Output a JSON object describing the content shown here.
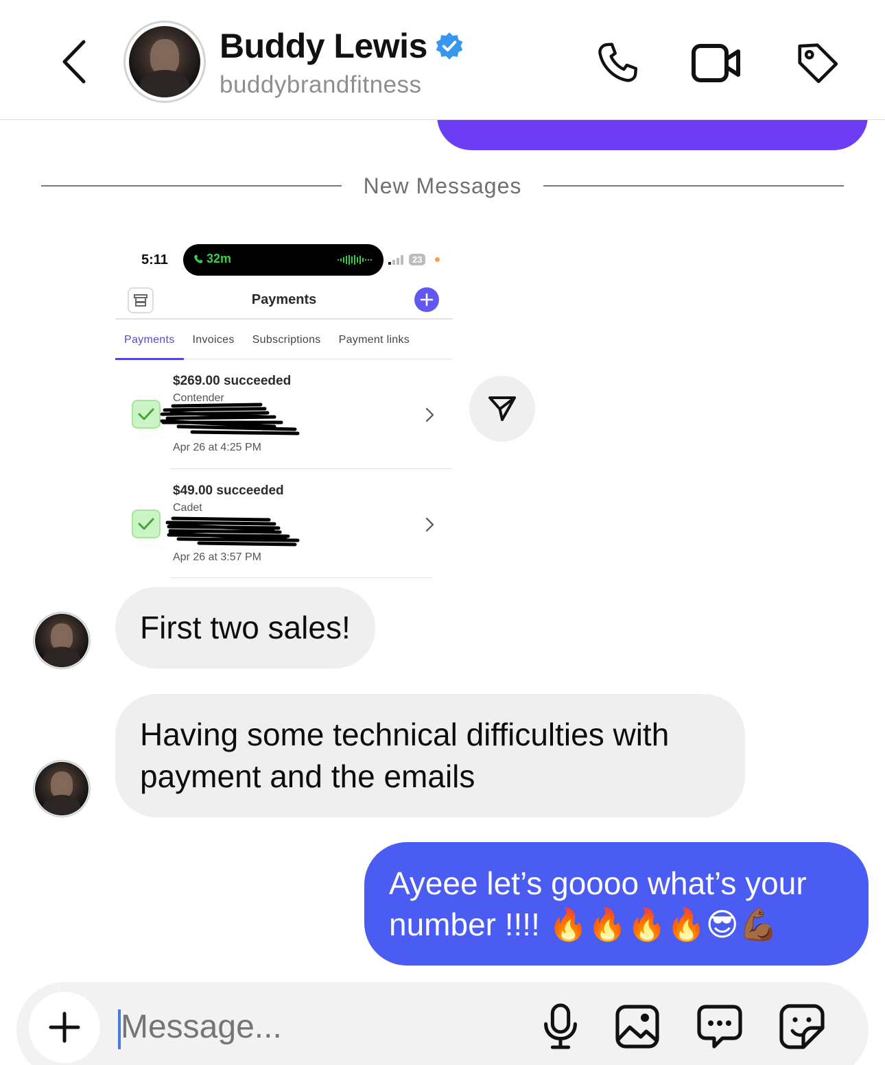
{
  "header": {
    "name": "Buddy Lewis",
    "username": "buddybrandfitness"
  },
  "divider": {
    "label": "New Messages"
  },
  "shared_screenshot": {
    "status_time": "5:11",
    "call_duration": "32m",
    "battery": "23",
    "app_title": "Payments",
    "tabs": [
      "Payments",
      "Invoices",
      "Subscriptions",
      "Payment links"
    ],
    "active_tab": "Payments",
    "payments": [
      {
        "amount_status": "$269.00 succeeded",
        "plan": "Contender",
        "date": "Apr 26 at 4:25 PM"
      },
      {
        "amount_status": "$49.00 succeeded",
        "plan": "Cadet",
        "date": "Apr 26 at 3:57 PM"
      }
    ]
  },
  "messages": [
    {
      "direction": "incoming",
      "text": "First two sales!"
    },
    {
      "direction": "incoming",
      "text": "Having some technical difficulties with payment and the emails"
    },
    {
      "direction": "outgoing",
      "text": "Ayeee let’s goooo what’s your number !!!! 🔥🔥🔥🔥😎💪🏾"
    }
  ],
  "composer": {
    "placeholder": "Message..."
  },
  "colors": {
    "outgoing_bubble": "#4b5cf2",
    "previous_bubble": "#6c3df5",
    "incoming_bubble": "#efefef",
    "verified": "#3797f0"
  }
}
